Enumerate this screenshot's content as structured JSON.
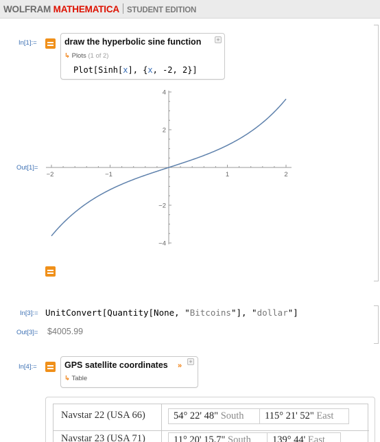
{
  "titlebar": {
    "wolfram": "WOLFRAM",
    "mathematica": "MATHEMATICA",
    "edition": "STUDENT EDITION"
  },
  "cell1": {
    "in_label": "In[1]:=",
    "query": "draw the hyperbolic sine function",
    "sub_kind": "Plots",
    "sub_count": "(1 of 2)",
    "code": {
      "fn": "Plot[Sinh[",
      "var": "x",
      "mid": "], {",
      "var2": "x",
      "tail": ", -2, 2}]"
    },
    "out_label": "Out[1]="
  },
  "plot": {
    "xticks": [
      "−2",
      "−1",
      "1",
      "2"
    ],
    "yticks": [
      "4",
      "2",
      "−2",
      "−4"
    ],
    "line_color": "#5e81ac"
  },
  "chart_data": {
    "type": "line",
    "function": "Sinh[x]",
    "xlim": [
      -2,
      2
    ],
    "ylim": [
      -4,
      4
    ],
    "x": [
      -2,
      -1.5,
      -1,
      -0.5,
      0,
      0.5,
      1,
      1.5,
      2
    ],
    "series": [
      {
        "values": [
          -3.63,
          -2.13,
          -1.18,
          -0.52,
          0,
          0.52,
          1.18,
          2.13,
          3.63
        ]
      }
    ],
    "x_ticks": [
      -2,
      -1,
      1,
      2
    ],
    "y_ticks": [
      4,
      2,
      -2,
      -4
    ],
    "grid": false
  },
  "cell3": {
    "in_label": "In[3]:=",
    "code": {
      "a": "UnitConvert[Quantity[None, \"",
      "s1": "Bitcoins",
      "b": "\"], \"",
      "s2": "dollar",
      "c": "\"]"
    },
    "out_label": "Out[3]=",
    "output": "$4005.99"
  },
  "cell4": {
    "in_label": "In[4]:=",
    "query": "GPS satellite coordinates",
    "more_arrow": "»",
    "sub_kind": "Table",
    "rows": [
      {
        "name": "Navstar 22 (USA 66)",
        "lat": "54° 22' 48\"",
        "lat_dir": "South",
        "lon": "115° 21' 52\"",
        "lon_dir": "East"
      },
      {
        "name": "Navstar 23 (USA 71)",
        "lat": "11° 20' 15.7\"",
        "lat_dir": "South",
        "lon": "139° 44'",
        "lon_dir": "East"
      }
    ]
  },
  "icons": {
    "plus": "+",
    "arrow": "↳"
  }
}
